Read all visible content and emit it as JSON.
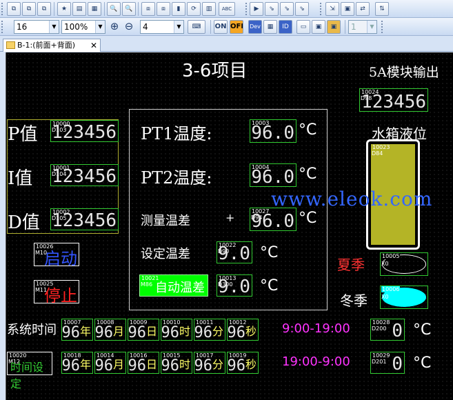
{
  "toolbar1": {
    "buttons": [
      "⧉",
      "⧉",
      "⧉",
      "★",
      "▤",
      "▦",
      "🔍",
      "⧈",
      "⧈",
      "▮",
      "⟳",
      "▥",
      "ABC",
      "▤",
      "▶",
      "⇘",
      "⇘",
      "⇘",
      "⇲",
      "▣",
      "⇄",
      "⇅"
    ]
  },
  "toolbar2": {
    "font_size": "16",
    "zoom": "100%",
    "zoom_in": "⊕",
    "zoom_out": "⊖",
    "grid_value": "4",
    "on_label": "ON",
    "off_label": "OFF",
    "dev_label": "Dev",
    "id_label": "ID",
    "layer_value": "1"
  },
  "tab": {
    "label": "B-1:(前面+背面)",
    "close": "✕"
  },
  "screen": {
    "title": "3-6项目",
    "output_title": "5A模块输出",
    "output_tag": "10024",
    "output_tag2": "D98",
    "output_value": "123456",
    "p_label": "P值",
    "i_label": "I值",
    "d_label": "D值",
    "p_tag": "10000",
    "p_tag2": "D103",
    "p_value": "123456",
    "i_tag": "10001",
    "i_tag2": "D104",
    "i_value": "123456",
    "d_tag": "10002",
    "d_tag2": "D105",
    "d_value": "123456",
    "pt1_label": "PT1温度:",
    "pt2_label": "PT2温度:",
    "pt1_tag": "10003",
    "pt1_value": "96.0",
    "pt2_tag": "10004",
    "pt2_value": "96.0",
    "measure_label": "测量温差",
    "measure_sign": "+",
    "measure_tag": "10027",
    "measure_tag2": "D94",
    "measure_value": "96.0",
    "set_label": "设定温差",
    "set_tag": "10022",
    "set_tag2": "D90",
    "set_value": "9.0",
    "auto_label": "自动温差",
    "auto_tag": "10021",
    "auto_tag2": "M86",
    "auto_val_tag": "10013",
    "auto_val_tag2": "D300",
    "auto_value": "9.0",
    "unit_c": "°C",
    "tank_label": "水箱液位",
    "tank_tag": "10023",
    "tank_tag2": "D84",
    "tank_level": 1.0,
    "start_tag": "10026",
    "start_tag2": "M10",
    "start_label": "启动",
    "stop_tag": "10025",
    "stop_tag2": "M11",
    "stop_label": "停止",
    "summer_label": "夏季",
    "summer_tag": "10005",
    "summer_tag2": "X0",
    "winter_label": "冬季",
    "winter_tag": "10006",
    "winter_tag2": "X0",
    "sys_time_label": "系统时间",
    "time_set_label": "时间设定",
    "time_set_tag": "10020",
    "time_set_tag2": "M12",
    "row1_tags": [
      "10007",
      "10008",
      "10009",
      "10010",
      "10011",
      "10012"
    ],
    "row1_values": [
      "96",
      "96",
      "96",
      "96",
      "96",
      "96"
    ],
    "row1_units": [
      "年",
      "月",
      "日",
      "时",
      "分",
      "秒"
    ],
    "row2_tags": [
      "10018",
      "10014",
      "10016",
      "10015",
      "10017",
      "10019"
    ],
    "row2_values": [
      "96",
      "96",
      "96",
      "96",
      "96",
      "96"
    ],
    "row2_units": [
      "年",
      "月",
      "日",
      "时",
      "分",
      "秒"
    ],
    "range1": "9:00-19:00",
    "range2": "19:00-9:00",
    "r1_tag": "10028",
    "r1_tag2": "D200",
    "r1_value": "0",
    "r2_tag": "10029",
    "r2_tag2": "D201",
    "r2_value": "0",
    "watermark": "www.eleok.com"
  },
  "colors": {
    "canvas": "#000000",
    "green_box": "#33cc33",
    "magenta": "#ff33ff",
    "yellow": "#ffff66",
    "tank": "#b4b426",
    "cyan": "#00ffff",
    "auto_button": "#00ff00",
    "start_blue": "#3355ff",
    "stop_red": "#ff2222",
    "summer_red": "#ff3333",
    "watermark": "#3366ff"
  }
}
